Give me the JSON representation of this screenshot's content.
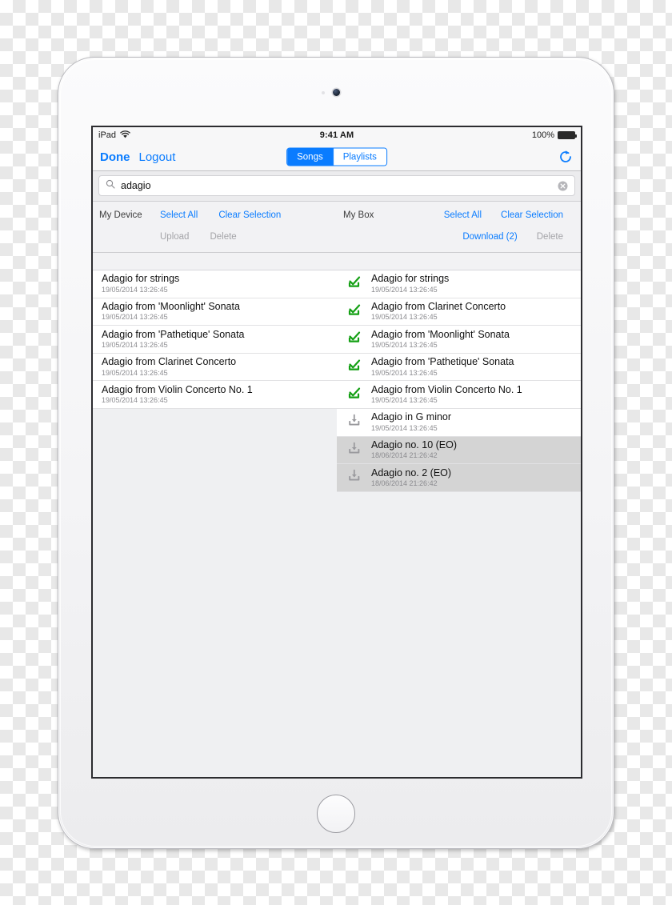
{
  "status_bar": {
    "device_label": "iPad",
    "wifi_icon": "wifi-icon",
    "time": "9:41 AM",
    "battery_percent": "100%",
    "battery_icon": "battery-full-icon"
  },
  "nav_bar": {
    "done_label": "Done",
    "logout_label": "Logout",
    "refresh_icon": "refresh-icon",
    "segments": [
      {
        "label": "Songs",
        "active": true
      },
      {
        "label": "Playlists",
        "active": false
      }
    ]
  },
  "search": {
    "icon": "search-icon",
    "value": "adagio",
    "placeholder": "Search",
    "clear_icon": "clear-circle-icon"
  },
  "toolbar": {
    "device": {
      "section_label": "My Device",
      "select_all": "Select All",
      "clear_selection": "Clear Selection",
      "upload": "Upload",
      "upload_enabled": false,
      "delete": "Delete",
      "delete_enabled": false
    },
    "box": {
      "section_label": "My Box",
      "select_all": "Select All",
      "clear_selection": "Clear Selection",
      "download": "Download (2)",
      "download_enabled": true,
      "delete": "Delete",
      "delete_enabled": false
    }
  },
  "colors": {
    "accent_blue": "#0a7cff",
    "check_green": "#15a015",
    "disabled_gray": "#a4a4a8",
    "selected_row": "#d4d4d4"
  },
  "device_list": [
    {
      "title": "Adagio for strings",
      "timestamp": "19/05/2014 13:26:45"
    },
    {
      "title": "Adagio from 'Moonlight' Sonata",
      "timestamp": "19/05/2014 13:26:45"
    },
    {
      "title": "Adagio from 'Pathetique' Sonata",
      "timestamp": "19/05/2014 13:26:45"
    },
    {
      "title": "Adagio from Clarinet Concerto",
      "timestamp": "19/05/2014 13:26:45"
    },
    {
      "title": "Adagio from Violin Concerto No. 1",
      "timestamp": "19/05/2014 13:26:45"
    }
  ],
  "box_list": [
    {
      "title": "Adagio for strings",
      "timestamp": "19/05/2014 13:26:45",
      "icon": "downloaded-check-icon",
      "selected": false
    },
    {
      "title": "Adagio from Clarinet Concerto",
      "timestamp": "19/05/2014 13:26:45",
      "icon": "downloaded-check-icon",
      "selected": false
    },
    {
      "title": "Adagio from 'Moonlight' Sonata",
      "timestamp": "19/05/2014 13:26:45",
      "icon": "downloaded-check-icon",
      "selected": false
    },
    {
      "title": "Adagio from 'Pathetique' Sonata",
      "timestamp": "19/05/2014 13:26:45",
      "icon": "downloaded-check-icon",
      "selected": false
    },
    {
      "title": "Adagio from Violin Concerto No. 1",
      "timestamp": "19/05/2014 13:26:45",
      "icon": "downloaded-check-icon",
      "selected": false
    },
    {
      "title": "Adagio in G minor",
      "timestamp": "19/05/2014 13:26:45",
      "icon": "download-arrow-icon",
      "selected": false
    },
    {
      "title": "Adagio no. 10 (EO)",
      "timestamp": "18/06/2014 21:26:42",
      "icon": "download-arrow-icon",
      "selected": true
    },
    {
      "title": "Adagio no. 2 (EO)",
      "timestamp": "18/06/2014 21:26:42",
      "icon": "download-arrow-icon",
      "selected": true
    }
  ]
}
